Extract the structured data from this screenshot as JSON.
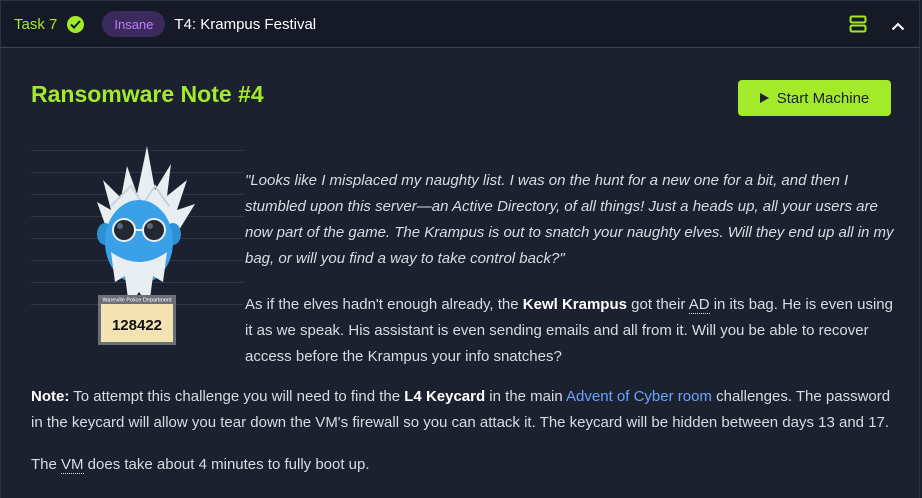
{
  "header": {
    "task_label": "Task 7",
    "difficulty": "Insane",
    "title": "T4: Krampus Festival"
  },
  "main": {
    "heading": "Ransomware Note #4",
    "start_button": "Start Machine",
    "mugshot": {
      "department": "Wareville Police Department",
      "number": "128422"
    },
    "quote": "\"Looks like I misplaced my naughty list. I was on the hunt for a new one for a bit, and then I stumbled upon this server—an Active Directory, of all things! Just a heads up, all your users are now part of the game. The Krampus is out to snatch your naughty elves. Will they end up all in my bag, or will you find a way to take control back?\"",
    "para1": {
      "t1": "As if the elves hadn't enough already, the ",
      "b1": "Kewl Krampus",
      "t2": " got their ",
      "abbr": "AD",
      "t3": " in its bag. He is even using it as we speak. His assistant is even sending emails and all from it. Will you be able to recover access before the Krampus your info snatches?"
    },
    "note": {
      "label": "Note:",
      "t1": " To attempt this challenge you will need to find the ",
      "b1": "L4 Keycard",
      "t2": " in the main ",
      "link": "Advent of Cyber room",
      "t3": " challenges. The password in the keycard will allow you tear down the VM's firewall so you can attack it. The keycard will be hidden between days 13 and 17."
    },
    "vm_note": {
      "t1": "The ",
      "abbr": "VM",
      "t2": " does take about 4 minutes to fully boot up."
    }
  },
  "colors": {
    "accent": "#a3ea2a",
    "background": "#1c2130",
    "header_bg": "#151a26",
    "badge_text": "#c07ef7",
    "link": "#6aa3ff"
  },
  "icons": [
    "check-circle-icon",
    "split-view-icon",
    "chevron-up-icon",
    "play-icon"
  ]
}
